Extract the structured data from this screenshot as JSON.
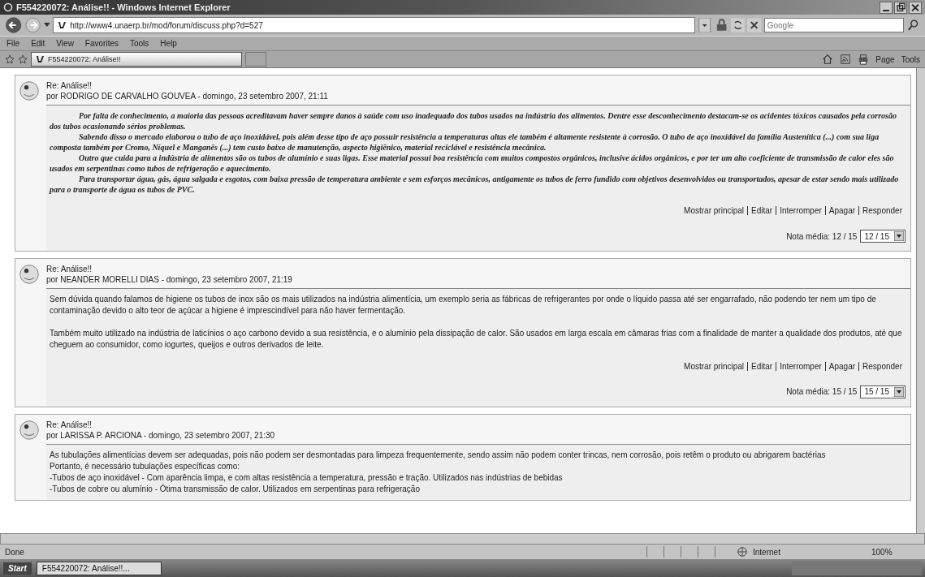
{
  "window": {
    "title": "F554220072: Análise!! - Windows Internet Explorer"
  },
  "address_bar": {
    "url": "http://www4.unaerp.br/mod/forum/discuss.php?d=527",
    "search_placeholder": "Google"
  },
  "menu": [
    "File",
    "Edit",
    "View",
    "Favorites",
    "Tools",
    "Help"
  ],
  "tab": {
    "label": "F554220072: Análise!!"
  },
  "command_bar": [
    "Page",
    "Tools"
  ],
  "posts": [
    {
      "kind": "formatted",
      "subject": "Re: Análise!!",
      "byline": "por RODRIGO DE CARVALHO GOUVEA - domingo, 23 setembro 2007, 21:11",
      "paragraphs": [
        "Por falta de conhecimento, a maioria das pessoas acreditavam haver sempre danos à saúde com uso inadequado dos tubos usados na indústria dos alimentos. Dentre esse desconhecimento destacam-se os acidentes tóxicos causados pela corrosão dos tubos ocasionando sérios problemas.",
        "Sabendo disso o mercado elaborou o tubo de aço inoxidável, pois além desse tipo de aço possuir resistência a temperaturas altas ele também é altamente resistente à corrosão. O tubo de aço inoxidável da família Austenítica (...) com sua liga composta também por Cromo, Níquel e Manganês (...) tem custo baixo de manutenção, aspecto higiênico, material reciclável e resistência mecânica.",
        "Outro que cuida para a indústria de alimentos são os tubos de alumínio e suas ligas. Esse material possui boa resistência com muitos compostos orgânicos, inclusive ácidos orgânicos, e por ter um alto coeficiente de transmissão de calor eles são usados em serpentinas como tubos de refrigeração e aquecimento.",
        "Para transportar água, gás, água salgada e esgotos, com baixa pressão de temperatura ambiente e sem esforços mecânicos, antigamente os tubos de ferro fundido com objetivos desenvolvidos ou transportados, apesar de estar sendo mais utilizado para o transporte de água os tubos de PVC."
      ],
      "links": [
        "Mostrar principal",
        "Editar",
        "Interromper",
        "Apagar",
        "Responder"
      ],
      "rating": {
        "label": "Nota média: 12 / 15",
        "value": "12 / 15"
      }
    },
    {
      "kind": "plain",
      "subject": "Re: Análise!!",
      "byline": "por NEANDER MORELLI DIAS - domingo, 23 setembro 2007, 21:19",
      "paragraphs": [
        "Sem dúvida quando falamos de higiene os tubos de inox são os mais utilizados na indústria alimentícia, um exemplo seria as fábricas de refrigerantes por onde o líquido passa até ser engarrafado, não podendo ter nem um tipo de contaminação devido o alto teor de açúcar a higiene é imprescindível para não haver fermentação.",
        "Também muito utilizado na indústria de laticínios o aço carbono devido a sua resistência, e o alumínio pela dissipação de calor. São usados em larga escala em câmaras frias com a finalidade de manter a qualidade dos produtos, até que cheguem ao consumidor, como iogurtes, queijos e outros derivados de leite."
      ],
      "links": [
        "Mostrar principal",
        "Editar",
        "Interromper",
        "Apagar",
        "Responder"
      ],
      "rating": {
        "label": "Nota média: 15 / 15",
        "value": "15 / 15"
      }
    },
    {
      "kind": "lines",
      "subject": "Re: Análise!!",
      "byline": "por LARISSA P. ARCIONA - domingo, 23 setembro 2007, 21:30",
      "paragraphs": [
        "As tubulações alimentícias devem ser adequadas, pois não podem ser desmontadas para limpeza frequentemente, sendo assim não podem conter trincas, nem corrosão, pois retêm o produto ou abrigarem bactérias",
        "Portanto, é necessário tubulações específicas como:",
        "-Tubos de aço inoxidável - Com aparência limpa, e com altas resistência a temperatura, pressão e tração. Utilizados nas indústrias de bebidas",
        "-Tubos de cobre ou alumínio - Ótima transmissão de calor. Utilizados em serpentinas para refrigeração"
      ]
    }
  ],
  "status_bar": {
    "text": "Done",
    "zone": "Internet",
    "zoom": "100%"
  },
  "taskbar": {
    "start": "Start",
    "tasks": [
      "F554220072: Análise!!..."
    ]
  }
}
